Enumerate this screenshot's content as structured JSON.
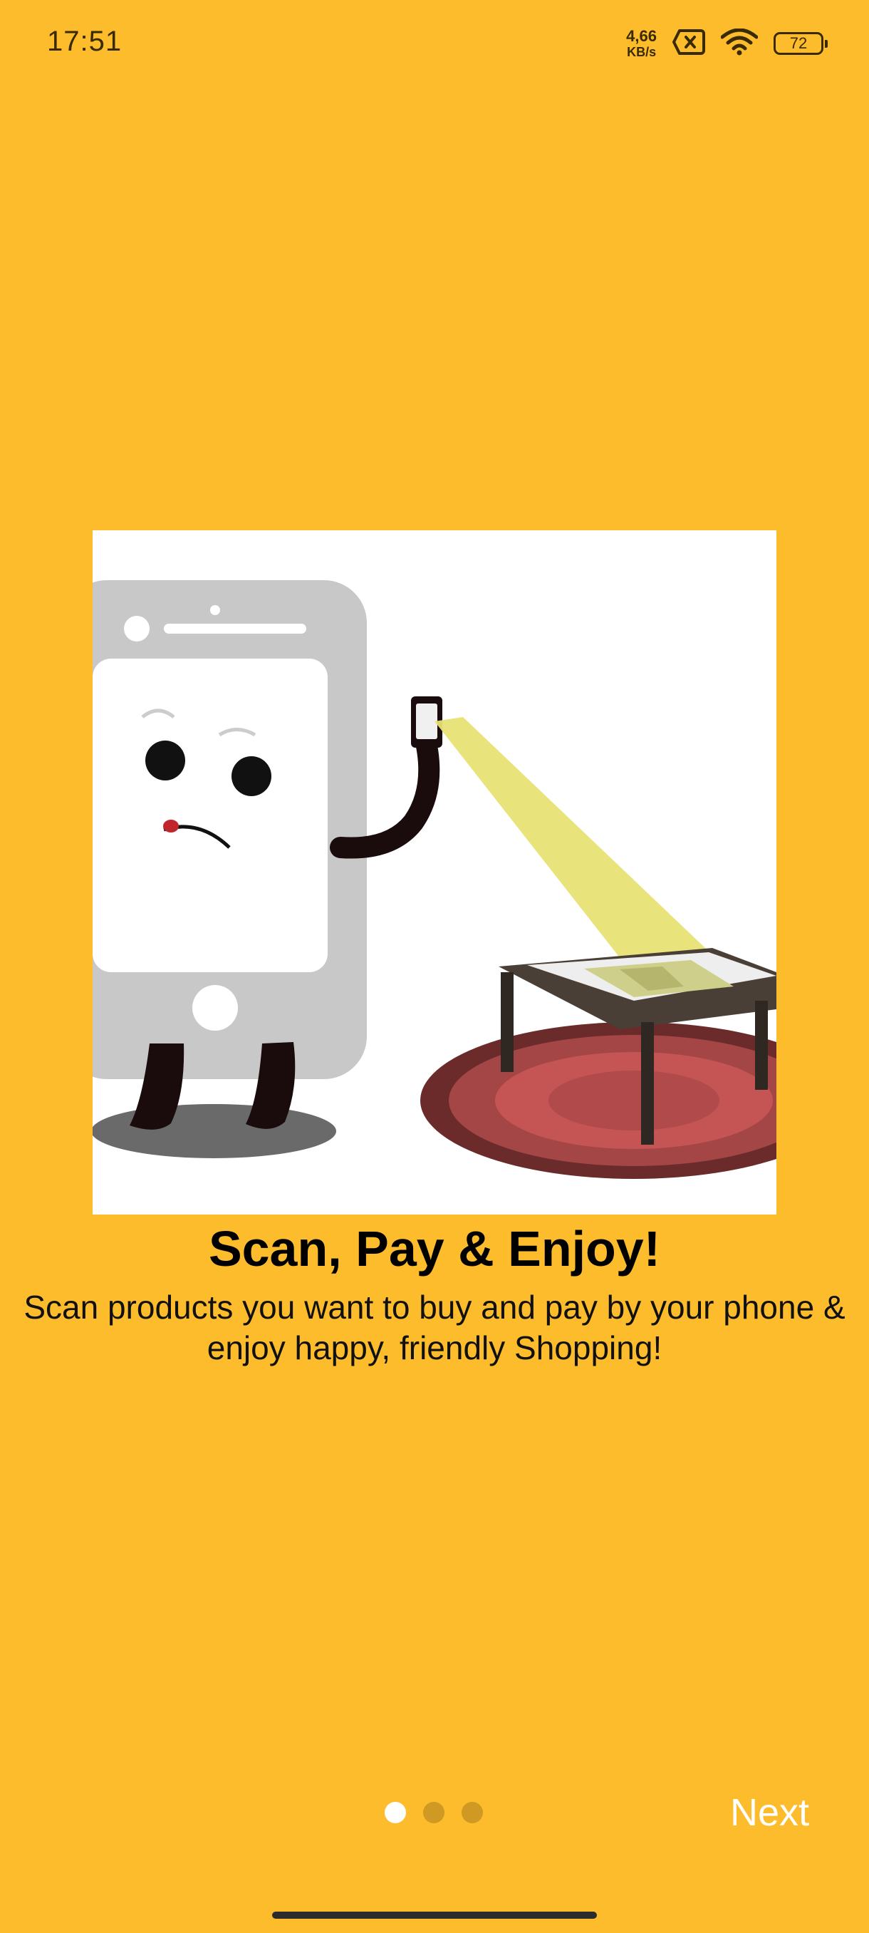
{
  "status_bar": {
    "time": "17:51",
    "net_speed_value": "4,66",
    "net_speed_unit": "KB/s",
    "battery": "72",
    "icons": [
      "sim-off-icon",
      "wifi-icon",
      "battery-icon"
    ]
  },
  "onboarding": {
    "illustration": "phone-scanning-illustration",
    "title": "Scan, Pay & Enjoy!",
    "subtitle_line1": "Scan products you want to buy and pay by your phone &",
    "subtitle_line2": "enjoy happy, friendly Shopping!",
    "page_count": 3,
    "current_page": 1,
    "next_label": "Next"
  },
  "colors": {
    "background": "#FDBC2C",
    "active_dot": "#FFFFFF",
    "next_text": "#FFFFFF"
  }
}
